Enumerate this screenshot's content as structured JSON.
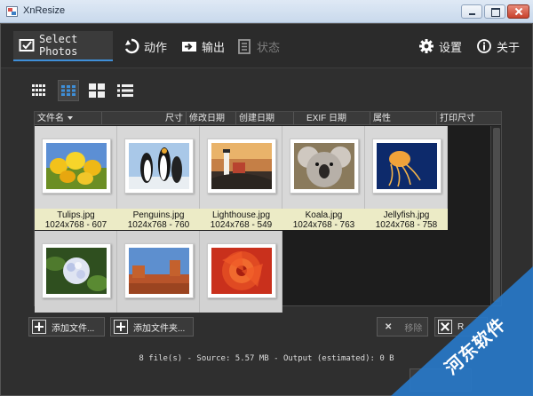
{
  "window": {
    "title": "XnResize"
  },
  "toolbar": {
    "tabs": [
      {
        "label": "Select Photos",
        "icon": "select-photos-icon",
        "active": true
      },
      {
        "label": "动作",
        "icon": "action-icon"
      },
      {
        "label": "输出",
        "icon": "output-icon"
      },
      {
        "label": "状态",
        "icon": "status-icon",
        "disabled": true
      }
    ],
    "settings_label": "设置",
    "about_label": "关于"
  },
  "view_modes": [
    "small-grid-icon",
    "medium-grid-icon",
    "large-grid-icon",
    "list-icon"
  ],
  "browser": {
    "columns": [
      "文件名",
      "尺寸",
      "修改日期",
      "创建日期",
      "EXIF 日期",
      "属性",
      "打印尺寸"
    ],
    "files": [
      {
        "name": "Tulips.jpg",
        "info": "1024x768 - 607",
        "thumb": "tulips"
      },
      {
        "name": "Penguins.jpg",
        "info": "1024x768 - 760",
        "thumb": "penguins"
      },
      {
        "name": "Lighthouse.jpg",
        "info": "1024x768 - 549",
        "thumb": "lighthouse"
      },
      {
        "name": "Koala.jpg",
        "info": "1024x768 - 763",
        "thumb": "koala"
      },
      {
        "name": "Jellyfish.jpg",
        "info": "1024x768 - 758",
        "thumb": "jellyfish"
      },
      {
        "name": "",
        "info": "",
        "thumb": "hydrangeas"
      },
      {
        "name": "",
        "info": "",
        "thumb": "desert"
      },
      {
        "name": "",
        "info": "",
        "thumb": "chrysanthemum"
      }
    ]
  },
  "buttons": {
    "add_file": "添加文件...",
    "add_folder": "添加文件夹...",
    "remove": "移除",
    "remove_all": "R"
  },
  "status": "8 file(s) - Source: 5.57 MB - Output (estimated): 0 B",
  "watermark": "河东软件",
  "colors": {
    "accent": "#3f8fd8",
    "background": "#2f2f2f",
    "caption_bg": "#ecebc6",
    "watermark": "#2878c8"
  }
}
